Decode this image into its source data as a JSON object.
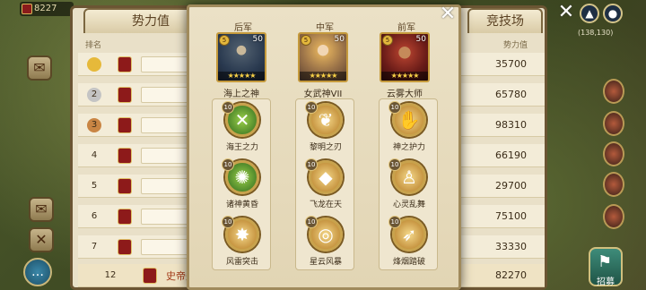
{
  "top_left": {
    "resource_value": "8227"
  },
  "rank_panel": {
    "tab_left": "势力值",
    "tab_right": "竞技场",
    "col_rank": "排名",
    "col_power": "势力值",
    "rows": [
      {
        "rank": "1",
        "power": "35700"
      },
      {
        "rank": "2",
        "power": "65780"
      },
      {
        "rank": "3",
        "power": "98310"
      },
      {
        "rank": "4",
        "power": "66190"
      },
      {
        "rank": "5",
        "power": "29700"
      },
      {
        "rank": "6",
        "power": "75100"
      },
      {
        "rank": "7",
        "power": "33330"
      },
      {
        "rank": "12",
        "name": "史帝夫",
        "power": "82270"
      }
    ]
  },
  "right_hud": {
    "coords": "(138,130)",
    "recruit_label": "招募"
  },
  "formation": {
    "positions": [
      "后军",
      "中军",
      "前军"
    ],
    "heroes": [
      {
        "name": "海上之神",
        "level": "50",
        "stars": "★★★★★"
      },
      {
        "name": "女武神VII",
        "level": "50",
        "stars": "★★★★★"
      },
      {
        "name": "云雾大师",
        "level": "50",
        "stars": "★★★★★"
      }
    ],
    "skills": [
      [
        {
          "name": "海王之力",
          "level": "10"
        },
        {
          "name": "诸神黄昏",
          "level": "10"
        },
        {
          "name": "风雷突击",
          "level": "10"
        }
      ],
      [
        {
          "name": "黎明之刃",
          "level": "10"
        },
        {
          "name": "飞龙在天",
          "level": "10"
        },
        {
          "name": "星云风暴",
          "level": "10"
        }
      ],
      [
        {
          "name": "神之护力",
          "level": "10"
        },
        {
          "name": "心灵乱舞",
          "level": "10"
        },
        {
          "name": "烽烟踏破",
          "level": "10"
        }
      ]
    ]
  },
  "icons": {
    "close": "close-icon",
    "chat": "chat-icon",
    "map": "map-pin-icon",
    "home": "home-icon"
  }
}
